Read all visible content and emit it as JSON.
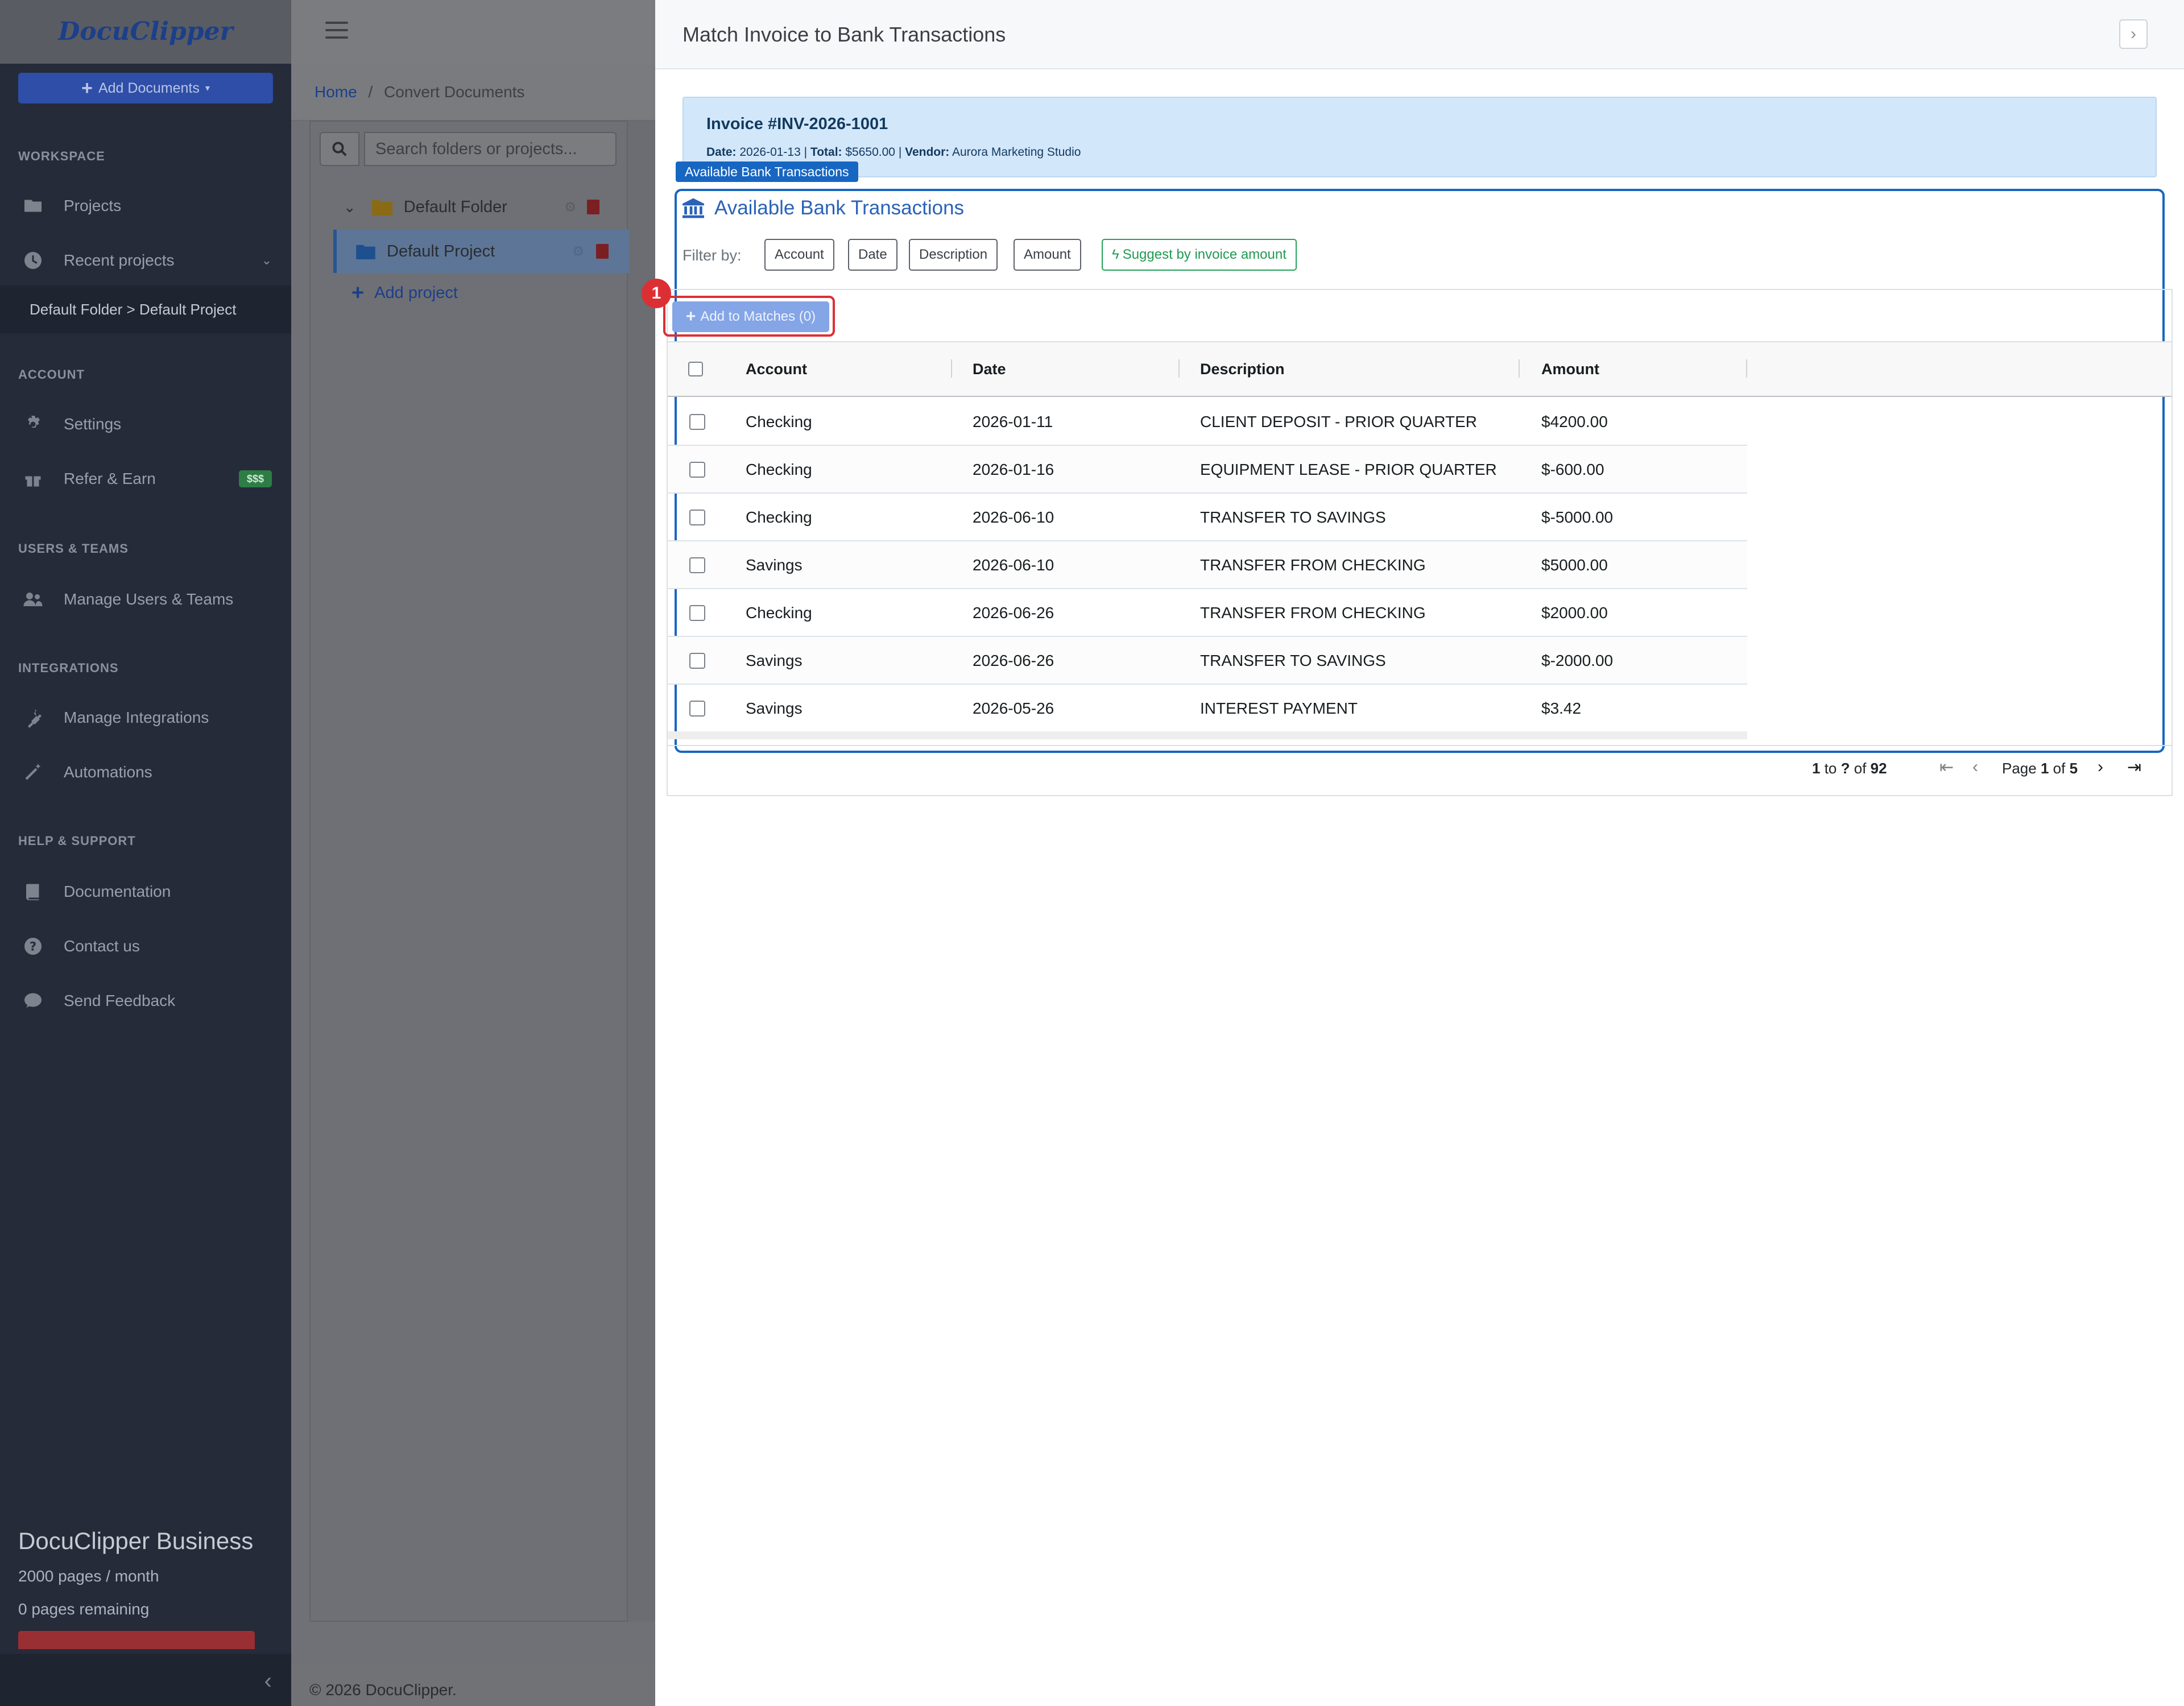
{
  "sidebar": {
    "logo": "DocuClipper",
    "add_documents": "Add Documents",
    "sections": {
      "workspace": "WORKSPACE",
      "account": "ACCOUNT",
      "users_teams": "USERS & TEAMS",
      "integrations": "INTEGRATIONS",
      "help": "HELP & SUPPORT"
    },
    "items": {
      "projects": "Projects",
      "recent": "Recent projects",
      "recent_sub": "Default Folder > Default Project",
      "settings": "Settings",
      "refer": "Refer & Earn",
      "refer_badge": "$$$",
      "manage_users": "Manage Users & Teams",
      "manage_integrations": "Manage Integrations",
      "automations": "Automations",
      "documentation": "Documentation",
      "contact": "Contact us",
      "feedback": "Send Feedback"
    },
    "plan": {
      "name": "DocuClipper Business",
      "pages": "2000 pages / month",
      "remaining": "0 pages remaining"
    }
  },
  "main": {
    "breadcrumb_home": "Home",
    "breadcrumb_sep": "/",
    "breadcrumb_current": "Convert Documents",
    "search_placeholder": "Search folders or projects...",
    "folder": "Default Folder",
    "project": "Default Project",
    "add_project": "Add project",
    "copyright": "© 2026 DocuClipper."
  },
  "drawer": {
    "title": "Match Invoice to Bank Transactions",
    "invoice": {
      "title": "Invoice #INV-2026-1001",
      "date_label": "Date:",
      "date": "2026-01-13",
      "total_label": "Total:",
      "total": "$5650.00",
      "vendor_label": "Vendor:",
      "vendor": "Aurora Marketing Studio"
    },
    "section_tag": "Available Bank Transactions",
    "section_title": "Available Bank Transactions",
    "filter_label": "Filter by:",
    "filters": [
      "Account",
      "Date",
      "Description",
      "Amount"
    ],
    "suggest": "Suggest by invoice amount",
    "add_matches": "Add to Matches (0)",
    "marker": "1",
    "columns": [
      "Account",
      "Date",
      "Description",
      "Amount"
    ],
    "rows": [
      {
        "account": "Checking",
        "date": "2026-01-11",
        "description": "CLIENT DEPOSIT - PRIOR QUARTER",
        "amount": "$4200.00"
      },
      {
        "account": "Checking",
        "date": "2026-01-16",
        "description": "EQUIPMENT LEASE - PRIOR QUARTER",
        "amount": "$-600.00"
      },
      {
        "account": "Checking",
        "date": "2026-06-10",
        "description": "TRANSFER TO SAVINGS",
        "amount": "$-5000.00"
      },
      {
        "account": "Savings",
        "date": "2026-06-10",
        "description": "TRANSFER FROM CHECKING",
        "amount": "$5000.00"
      },
      {
        "account": "Checking",
        "date": "2026-06-26",
        "description": "TRANSFER FROM CHECKING",
        "amount": "$2000.00"
      },
      {
        "account": "Savings",
        "date": "2026-06-26",
        "description": "TRANSFER TO SAVINGS",
        "amount": "$-2000.00"
      },
      {
        "account": "Savings",
        "date": "2026-05-26",
        "description": "INTEREST PAYMENT",
        "amount": "$3.42"
      }
    ],
    "pager": {
      "from": "1",
      "to_word": "to",
      "to": "?",
      "of_word": "of",
      "total": "92",
      "page_word": "Page",
      "page": "1",
      "pages": "5"
    }
  }
}
